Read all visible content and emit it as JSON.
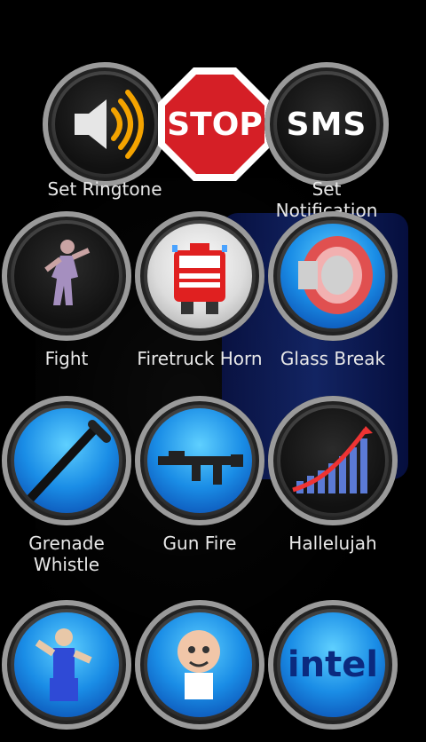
{
  "buttons": [
    {
      "label": "Set Ringtone"
    },
    {
      "label": "STOP"
    },
    {
      "label": "SMS"
    },
    {
      "label": "Fight"
    },
    {
      "label": "Firetruck Horn"
    },
    {
      "label": "Glass Break"
    },
    {
      "label": "Grenade\nWhistle"
    },
    {
      "label": "Gun Fire"
    },
    {
      "label": "Hallelujah"
    },
    {
      "label": ""
    },
    {
      "label": ""
    },
    {
      "label": "intel"
    }
  ],
  "labels": {
    "set_notification": "Set\nNotification"
  },
  "colors": {
    "background": "#000000",
    "button_blue": "#1a8de6",
    "stop_red": "#d51f26"
  }
}
